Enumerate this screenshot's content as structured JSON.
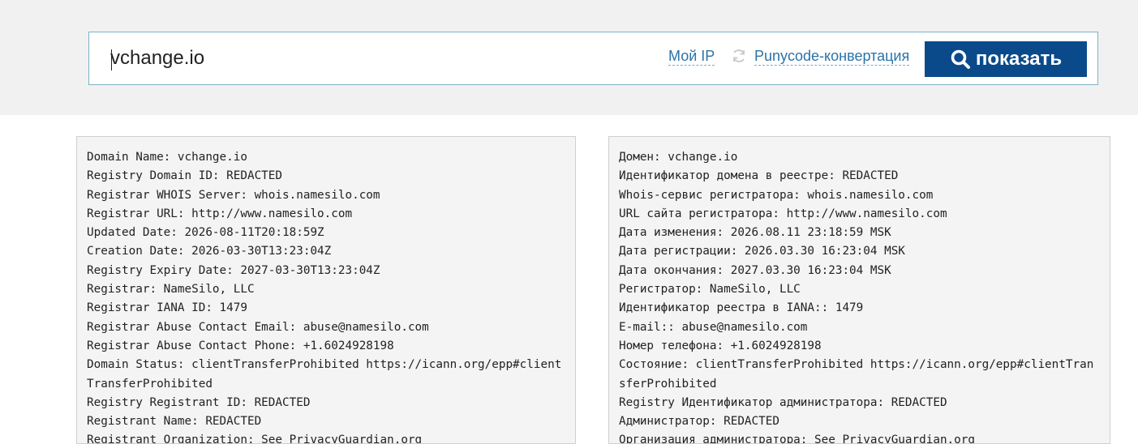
{
  "search": {
    "value": "vchange.io",
    "my_ip_label": "Мой IP",
    "punycode_label": "Punycode-конвертация",
    "show_label": "показать"
  },
  "whois_original": [
    "Domain Name: vchange.io",
    "Registry Domain ID: REDACTED",
    "Registrar WHOIS Server: whois.namesilo.com",
    "Registrar URL: http://www.namesilo.com",
    "Updated Date: 2026-08-11T20:18:59Z",
    "Creation Date: 2026-03-30T13:23:04Z",
    "Registry Expiry Date: 2027-03-30T13:23:04Z",
    "Registrar: NameSilo, LLC",
    "Registrar IANA ID: 1479",
    "Registrar Abuse Contact Email: abuse@namesilo.com",
    "Registrar Abuse Contact Phone: +1.6024928198",
    "Domain Status: clientTransferProhibited https://icann.org/epp#clientTransferProhibited",
    "Registry Registrant ID: REDACTED",
    "Registrant Name: REDACTED",
    "Registrant Organization: See PrivacyGuardian.org"
  ],
  "whois_translated": [
    "Домен: vchange.io",
    "Идентификатор домена в реестре: REDACTED",
    "Whois-сервис регистратора: whois.namesilo.com",
    "URL сайта регистратора: http://www.namesilo.com",
    "Дата изменения: 2026.08.11 23:18:59 MSK",
    "Дата регистрации: 2026.03.30 16:23:04 MSK",
    "Дата окончания: 2027.03.30 16:23:04 MSK",
    "Регистратор: NameSilo, LLC",
    "Идентификатор реестра в IANA:: 1479",
    "E-mail:: abuse@namesilo.com",
    "Номер телефона: +1.6024928198",
    "Состояние: clientTransferProhibited https://icann.org/epp#clientTransferProhibited",
    "Registry Идентификатор администратора: REDACTED",
    "Администратор: REDACTED",
    "Организация администратора: See PrivacyGuardian.org"
  ],
  "colors": {
    "accent": "#0b4a8a",
    "link": "#2a73a8",
    "band": "#f1f1f1",
    "panel": "#f4f4f4"
  },
  "icons": [
    "refresh-icon",
    "search-icon"
  ]
}
